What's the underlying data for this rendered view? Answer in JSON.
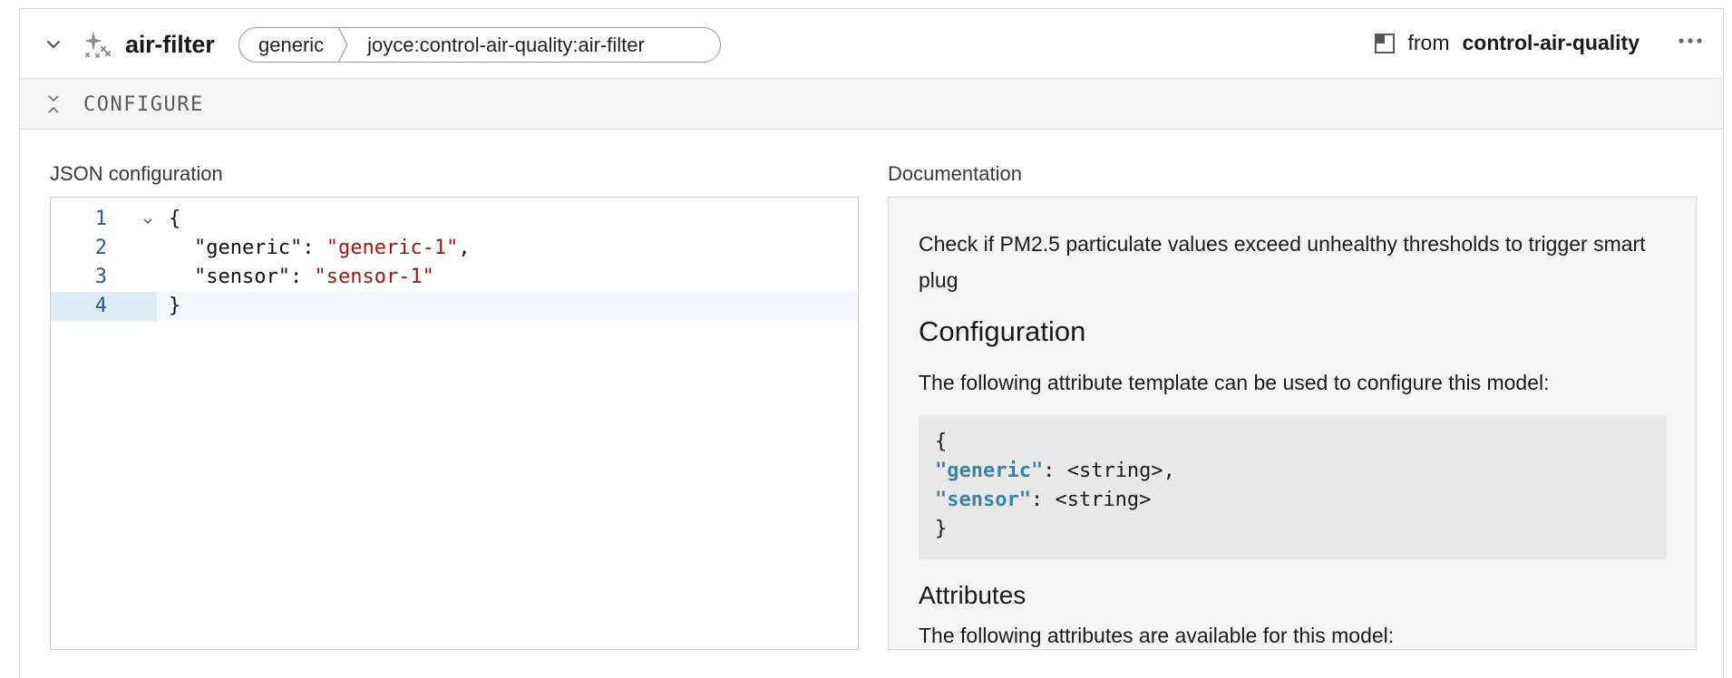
{
  "header": {
    "title": "air-filter",
    "breadcrumbs": [
      "generic",
      "joyce:control-air-quality:air-filter"
    ],
    "from_prefix": "from",
    "from_name": "control-air-quality"
  },
  "config_bar": {
    "label": "CONFIGURE"
  },
  "json_config": {
    "label": "JSON configuration",
    "lines": [
      {
        "number": "1",
        "open": "{"
      },
      {
        "number": "2",
        "key": "\"generic\"",
        "sep": ": ",
        "value": "\"generic-1\"",
        "end": ","
      },
      {
        "number": "3",
        "key": "\"sensor\"",
        "sep": ": ",
        "value": "\"sensor-1\"",
        "end": ""
      },
      {
        "number": "4",
        "close": "}"
      }
    ]
  },
  "documentation": {
    "label": "Documentation",
    "description": "Check if PM2.5 particulate values exceed unhealthy thresholds to trigger smart plug",
    "configuration_heading": "Configuration",
    "configuration_text": "The following attribute template can be used to configure this model:",
    "template": {
      "open": "{",
      "k1": "\"generic\"",
      "v1": ": <string>,",
      "k2": "\"sensor\"",
      "v2": ": <string>",
      "close": "}"
    },
    "attributes_heading": "Attributes",
    "attributes_text": "The following attributes are available for this model:"
  },
  "colors": {
    "string_value": "#a31515",
    "template_key": "#3b84a8",
    "line_number": "#2a5a8a"
  }
}
